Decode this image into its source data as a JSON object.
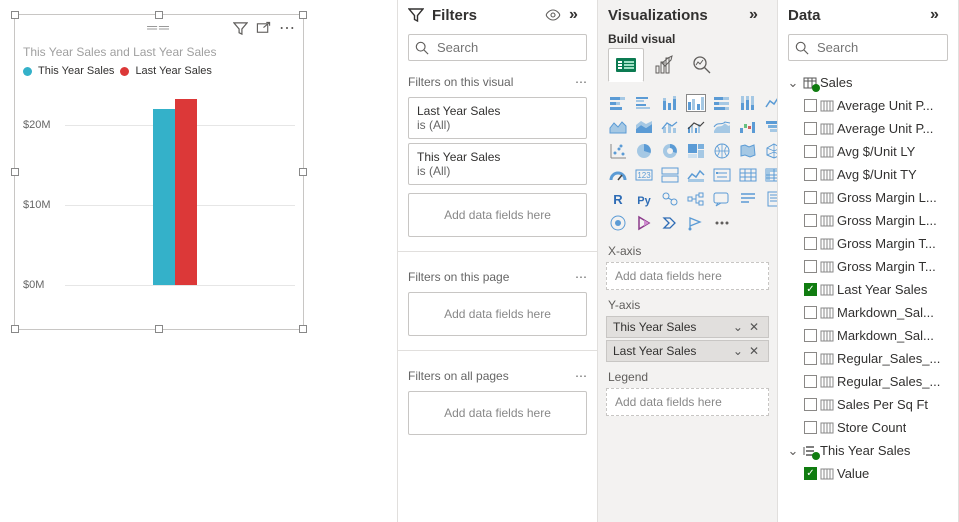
{
  "panels": {
    "filters": {
      "title": "Filters",
      "search_placeholder": "Search"
    },
    "viz": {
      "title": "Visualizations",
      "build_label": "Build visual"
    },
    "data": {
      "title": "Data",
      "search_placeholder": "Search"
    }
  },
  "canvas_visual": {
    "title": "This Year Sales and Last Year Sales",
    "legend": [
      {
        "label": "This Year Sales",
        "color": "#34b1c9"
      },
      {
        "label": "Last Year Sales",
        "color": "#dc3838"
      }
    ]
  },
  "chart_data": {
    "type": "bar",
    "title": "This Year Sales and Last Year Sales",
    "ylabel": "",
    "xlabel": "",
    "ylim": [
      0,
      25000000
    ],
    "yticks": [
      "$0M",
      "$10M",
      "$20M"
    ],
    "series": [
      {
        "name": "This Year Sales",
        "values": [
          22000000
        ],
        "color": "#34b1c9"
      },
      {
        "name": "Last Year Sales",
        "values": [
          23200000
        ],
        "color": "#dc3838"
      }
    ],
    "categories": [
      ""
    ]
  },
  "filters": {
    "on_visual_label": "Filters on this visual",
    "on_page_label": "Filters on this page",
    "on_all_label": "Filters on all pages",
    "add_text": "Add data fields here",
    "cards": [
      {
        "name": "Last Year Sales",
        "state": "is (All)"
      },
      {
        "name": "This Year Sales",
        "state": "is (All)"
      }
    ]
  },
  "viz_wells": {
    "xaxis": {
      "label": "X-axis",
      "placeholder": "Add data fields here",
      "pills": []
    },
    "yaxis": {
      "label": "Y-axis",
      "placeholder": "",
      "pills": [
        "This Year Sales",
        "Last Year Sales"
      ]
    },
    "legend": {
      "label": "Legend",
      "placeholder": "Add data fields here",
      "pills": []
    }
  },
  "data_tree": {
    "tables": [
      {
        "name": "Sales",
        "expanded": true,
        "fields": [
          {
            "name": "Average Unit P...",
            "checked": false,
            "icon": "measure"
          },
          {
            "name": "Average Unit P...",
            "checked": false,
            "icon": "measure"
          },
          {
            "name": "Avg $/Unit LY",
            "checked": false,
            "icon": "measure"
          },
          {
            "name": "Avg $/Unit TY",
            "checked": false,
            "icon": "measure"
          },
          {
            "name": "Gross Margin L...",
            "checked": false,
            "icon": "measure"
          },
          {
            "name": "Gross Margin L...",
            "checked": false,
            "icon": "measure"
          },
          {
            "name": "Gross Margin T...",
            "checked": false,
            "icon": "measure"
          },
          {
            "name": "Gross Margin T...",
            "checked": false,
            "icon": "measure"
          },
          {
            "name": "Last Year Sales",
            "checked": true,
            "icon": "measure"
          },
          {
            "name": "Markdown_Sal...",
            "checked": false,
            "icon": "measure"
          },
          {
            "name": "Markdown_Sal...",
            "checked": false,
            "icon": "measure"
          },
          {
            "name": "Regular_Sales_...",
            "checked": false,
            "icon": "measure"
          },
          {
            "name": "Regular_Sales_...",
            "checked": false,
            "icon": "measure"
          },
          {
            "name": "Sales Per Sq Ft",
            "checked": false,
            "icon": "measure"
          },
          {
            "name": "Store Count",
            "checked": false,
            "icon": "measure"
          }
        ]
      },
      {
        "name": "This Year Sales",
        "expanded": true,
        "is_hierarchy": true,
        "fields": [
          {
            "name": "Value",
            "checked": true,
            "icon": "measure"
          }
        ]
      }
    ]
  }
}
